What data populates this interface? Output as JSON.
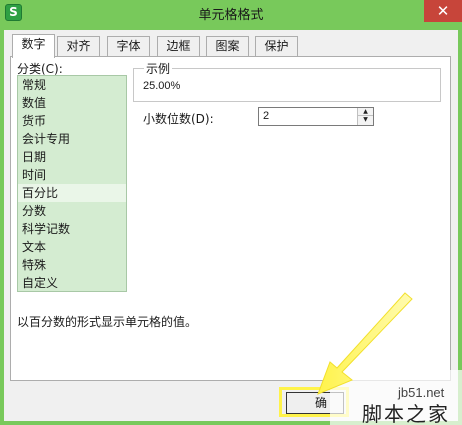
{
  "window": {
    "title": "单元格格式",
    "app_icon_glyph": "S",
    "close_glyph": "✕"
  },
  "tabs": [
    {
      "label": "数字",
      "active": true
    },
    {
      "label": "对齐",
      "active": false
    },
    {
      "label": "字体",
      "active": false
    },
    {
      "label": "边框",
      "active": false
    },
    {
      "label": "图案",
      "active": false
    },
    {
      "label": "保护",
      "active": false
    }
  ],
  "category": {
    "label": "分类(C):",
    "items": [
      "常规",
      "数值",
      "货币",
      "会计专用",
      "日期",
      "时间",
      "百分比",
      "分数",
      "科学记数",
      "文本",
      "特殊",
      "自定义"
    ],
    "selected": "百分比"
  },
  "sample": {
    "label": "示例",
    "value": "25.00%"
  },
  "decimal": {
    "label": "小数位数(D):",
    "value": "2"
  },
  "description": "以百分数的形式显示单元格的值。",
  "ok_label": "确",
  "watermark": {
    "url": "jb51.net",
    "site": "脚本之家"
  },
  "colors": {
    "title_bar": "#78c95b",
    "list_bg": "#d4ecd1",
    "highlight": "#fff34a"
  }
}
